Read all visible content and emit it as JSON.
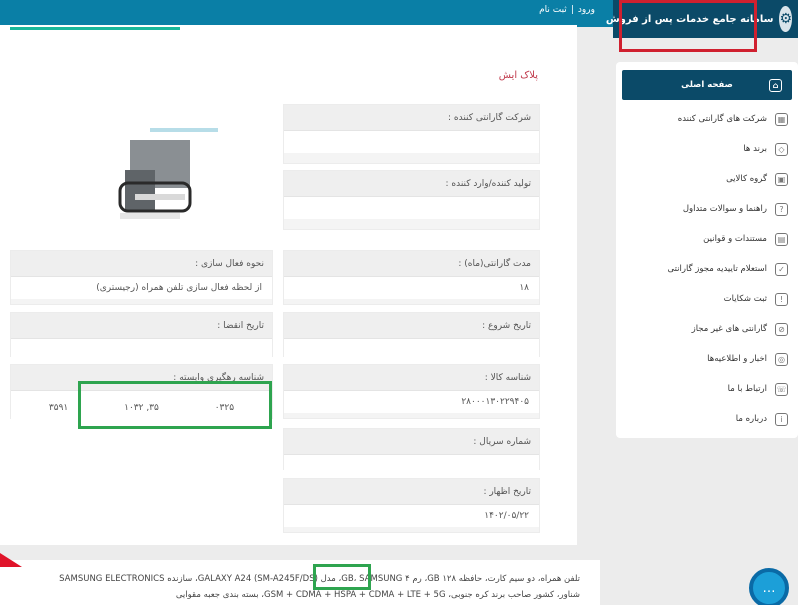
{
  "header": {
    "title": "سامانه جامع خدمات پس از فروش",
    "login": "ورود",
    "separator": "|",
    "register": "ثبت نام"
  },
  "page": {
    "heading": "پلاک ایش"
  },
  "fields": {
    "warranty_company": {
      "label": "شرکت گارانتی کننده :",
      "value": ""
    },
    "producer": {
      "label": "تولید کننده/وارد کننده :",
      "value": ""
    },
    "activation_method": {
      "label": "نحوه فعال سازی :",
      "value": "از لحظه فعال سازی تلفن همراه (رجیستری)"
    },
    "warranty_duration": {
      "label": "مدت گارانتی(ماه) :",
      "value": "۱۸"
    },
    "expiry_date": {
      "label": "تاریخ انقضا :",
      "value": ""
    },
    "start_date": {
      "label": "تاریخ شروع :",
      "value": ""
    },
    "color_id": {
      "label": "شناسه رهگیری وابسته :",
      "values": [
        "۳۵۹۱",
        "۱۰۳۲ ,۳۵",
        "۰۳۲۵"
      ]
    },
    "product_id": {
      "label": "شناسه کالا :",
      "value": "۲۸۰۰۰۱۳۰۲۲۹۴۰۵"
    },
    "serial": {
      "label": "شماره سریال :",
      "value": ""
    },
    "declaration_date": {
      "label": "تاریخ اظهار :",
      "value": "۱۴۰۲/۰۵/۲۲"
    }
  },
  "sidebar": {
    "items": [
      {
        "label": "صفحه اصلی",
        "icon": "home-icon",
        "glyph": "⌂"
      },
      {
        "label": "شرکت های گارانتی کننده",
        "icon": "building-icon",
        "glyph": "▦"
      },
      {
        "label": "برند ها",
        "icon": "tag-icon",
        "glyph": "◇"
      },
      {
        "label": "گروه کالایی",
        "icon": "box-icon",
        "glyph": "▣"
      },
      {
        "label": "راهنما و سوالات متداول",
        "icon": "help-icon",
        "glyph": "?"
      },
      {
        "label": "مستندات و قوانین",
        "icon": "book-icon",
        "glyph": "▤"
      },
      {
        "label": "استعلام تاییدیه مجوز گارانتی",
        "icon": "certificate-icon",
        "glyph": "✓"
      },
      {
        "label": "ثبت شکایات",
        "icon": "complaint-icon",
        "glyph": "!"
      },
      {
        "label": "گارانتی های غیر مجاز",
        "icon": "block-icon",
        "glyph": "⊘"
      },
      {
        "label": "اخبار و اطلاعیه‌ها",
        "icon": "news-icon",
        "glyph": "◎"
      },
      {
        "label": "ارتباط با ما",
        "icon": "phone-icon",
        "glyph": "☏"
      },
      {
        "label": "درباره ما",
        "icon": "info-icon",
        "glyph": "i"
      }
    ]
  },
  "bottom": {
    "line1": "تلفن همراه، دو سیم کارت، حافظه ۱۲۸ GB، رم ۴ GB، SAMSUNG، مدل GALAXY A24 (SM-A245F/DS)، سازنده SAMSUNG ELECTRONICS",
    "line2": "شناور، کشور صاحب برند کره جنوبی، GSM + CDMA + HSPA + CDMA + LTE + 5G، بسته بندی جعبه مقوایی"
  },
  "chat": {
    "icon": "chat-icon"
  },
  "colors": {
    "accent": "#0b4a68",
    "topbar": "#0a7fa6",
    "highlight_red": "#d0202f",
    "highlight_green": "#2ea44f"
  }
}
